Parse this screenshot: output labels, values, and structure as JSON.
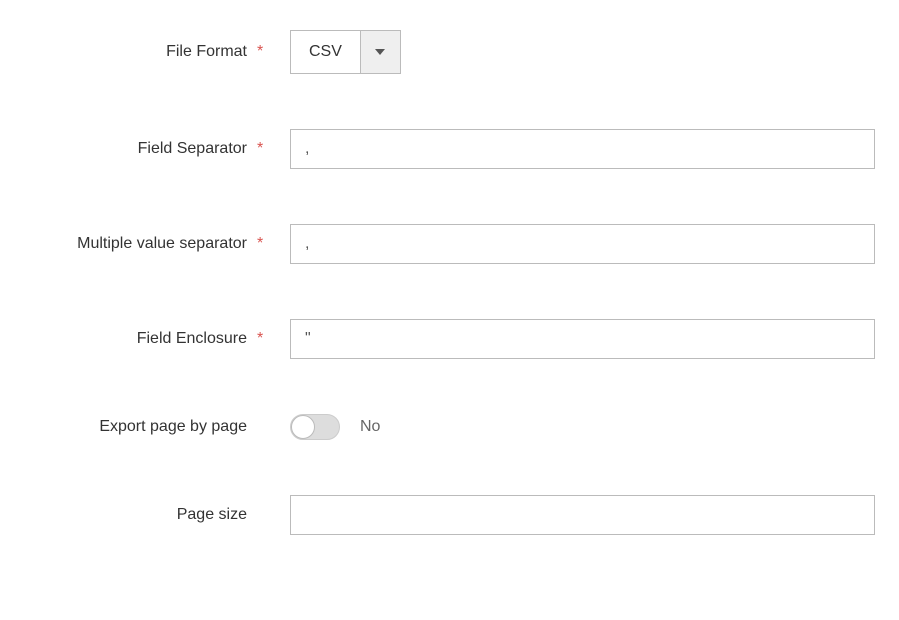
{
  "fields": {
    "file_format": {
      "label": "File Format",
      "required": true,
      "value": "CSV"
    },
    "field_separator": {
      "label": "Field Separator",
      "required": true,
      "value": ","
    },
    "multiple_value_separator": {
      "label": "Multiple value separator",
      "required": true,
      "value": ","
    },
    "field_enclosure": {
      "label": "Field Enclosure",
      "required": true,
      "value": "\""
    },
    "export_page_by_page": {
      "label": "Export page by page",
      "required": false,
      "state_label": "No"
    },
    "page_size": {
      "label": "Page size",
      "required": false,
      "value": ""
    }
  }
}
